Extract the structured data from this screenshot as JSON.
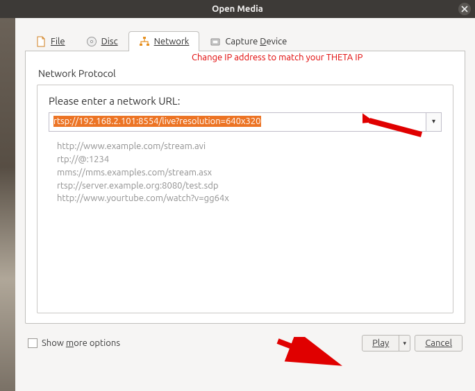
{
  "window": {
    "title": "Open Media"
  },
  "tabs": {
    "file": "File",
    "disc": "Disc",
    "network": "Network",
    "capture": "Capture Device"
  },
  "section": {
    "header": "Network Protocol"
  },
  "annotation": {
    "text": "Change IP address to match your THETA IP"
  },
  "network": {
    "prompt": "Please enter a network URL:",
    "url": "rtsp://192.168.2.101:8554/live?resolution=640x320",
    "examples": [
      "http://www.example.com/stream.avi",
      "rtp://@:1234",
      "mms://mms.examples.com/stream.asx",
      "rtsp://server.example.org:8080/test.sdp",
      "http://www.yourtube.com/watch?v=gg64x"
    ]
  },
  "footer": {
    "show_more": "Show more options",
    "play": "Play",
    "cancel": "Cancel"
  }
}
